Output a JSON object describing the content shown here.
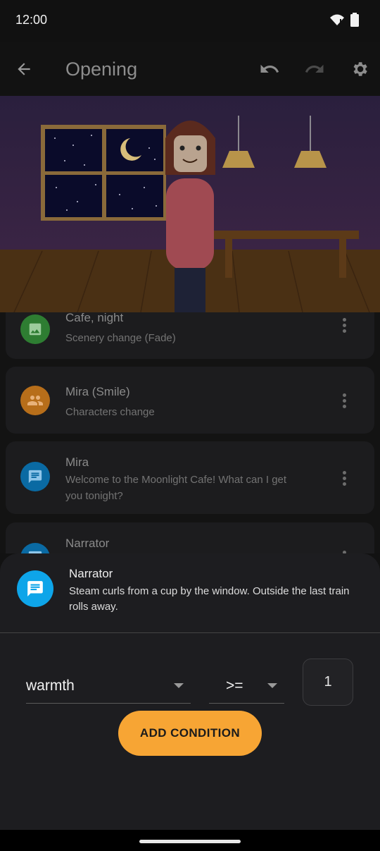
{
  "status_bar": {
    "time": "12:00"
  },
  "app_bar": {
    "title": "Opening",
    "back_icon": "arrow-back-icon",
    "undo_icon": "undo-icon",
    "redo_icon": "redo-icon",
    "settings_icon": "settings-gear-icon"
  },
  "event_list": [
    {
      "title": "Cafe, night",
      "subtitle": "Scenery change (Fade)",
      "icon": "image-icon",
      "color": "#2e7d32"
    },
    {
      "title": "Mira (Smile)",
      "subtitle": "Characters change",
      "icon": "people-icon",
      "color": "#b76e1a"
    },
    {
      "title": "Mira",
      "subtitle": "Welcome to the Moonlight Cafe! What can I get you tonight?",
      "icon": "chat-icon",
      "color": "#0a6aa3"
    },
    {
      "title": "Narrator",
      "subtitle": "",
      "icon": "chat-icon",
      "color": "#0a6aa3"
    }
  ],
  "sheet": {
    "speaker": "Narrator",
    "text": "Steam curls from a cup by the window. Outside the last train rolls away.",
    "condition": {
      "variable": "warmth",
      "operator": ">=",
      "value": "1"
    },
    "add_button_label": "ADD CONDITION"
  },
  "colors": {
    "accent": "#f7a534",
    "narrator_avatar": "#0ea5e9"
  }
}
